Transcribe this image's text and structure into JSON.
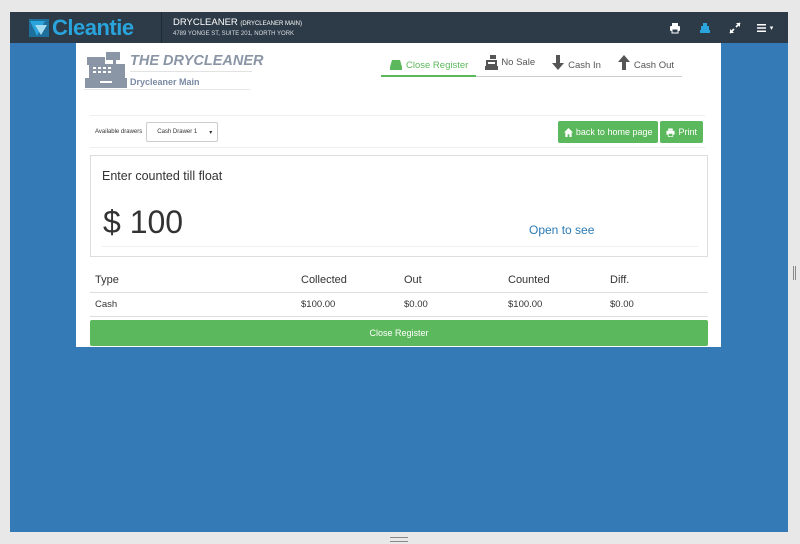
{
  "topbar": {
    "logo_prefix": "Clean",
    "logo_suffix": "tie",
    "store_name": "DRYCLEANER",
    "store_sub": "(DRYCLEANER MAIN)",
    "store_address": "4789 YONGE ST, SUITE 201, NORTH YORK",
    "icons": [
      "print-icon",
      "cash-register-icon",
      "expand-icon",
      "menu-icon"
    ],
    "menu_caret": "▾"
  },
  "brand": {
    "title": "THE DRYCLEANER",
    "subtitle": "Drycleaner Main"
  },
  "nav": {
    "close_register": "Close Register",
    "no_sale": "No Sale",
    "cash_in": "Cash In",
    "cash_out": "Cash Out"
  },
  "drawers": {
    "label": "Available drawers",
    "selected": "Cash Drawer 1",
    "caret": "▾"
  },
  "buttons": {
    "home": "back to home page",
    "print": "Print"
  },
  "float": {
    "title": "Enter counted till float",
    "amount": "$ 100",
    "open_link": "Open to see"
  },
  "table": {
    "headers": [
      "Type",
      "Collected",
      "Out",
      "Counted",
      "Diff."
    ],
    "rows": [
      [
        "Cash",
        "$100.00",
        "$0.00",
        "$100.00",
        "$0.00"
      ]
    ]
  },
  "close_button": "Close Register",
  "colors": {
    "green": "#5cb85c",
    "blue_bg": "#337ab7",
    "topbar": "#2d3b48",
    "link": "#2a7ab5",
    "brand_text": "#8a95a5"
  }
}
